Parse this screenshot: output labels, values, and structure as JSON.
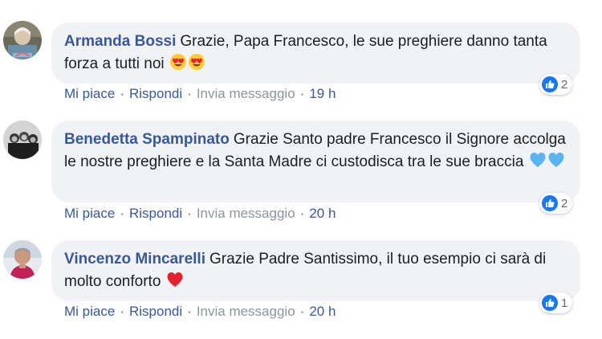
{
  "comments": [
    {
      "author": "Armanda Bossi",
      "text": "Grazie, Papa Francesco, le sue preghiere danno tanta forza a tutti noi",
      "emojis": [
        "heart-eyes-emoji",
        "heart-eyes-emoji"
      ],
      "reaction_count": "2",
      "actions": {
        "like": "Mi piace",
        "reply": "Rispondi",
        "message": "Invia messaggio",
        "time": "19 h"
      }
    },
    {
      "author": "Benedetta Spampinato",
      "text": "Grazie Santo padre Francesco il Signore accolga le nostre preghiere e la Santa Madre ci custodisca tra le sue braccia",
      "emojis": [
        "blue-heart-emoji",
        "blue-heart-emoji"
      ],
      "reaction_count": "2",
      "actions": {
        "like": "Mi piace",
        "reply": "Rispondi",
        "message": "Invia messaggio",
        "time": "20 h"
      }
    },
    {
      "author": "Vincenzo Mincarelli",
      "text": "Grazie Padre Santissimo, il tuo esempio ci sarà di molto conforto",
      "emojis": [
        "red-heart-emoji"
      ],
      "reaction_count": "1",
      "actions": {
        "like": "Mi piace",
        "reply": "Rispondi",
        "message": "Invia messaggio",
        "time": "20 h"
      }
    }
  ],
  "separator": "·",
  "colors": {
    "author": "#385898",
    "bubble": "#f0f2f5",
    "meta": "#65676b",
    "like_badge": "#1877f2"
  }
}
